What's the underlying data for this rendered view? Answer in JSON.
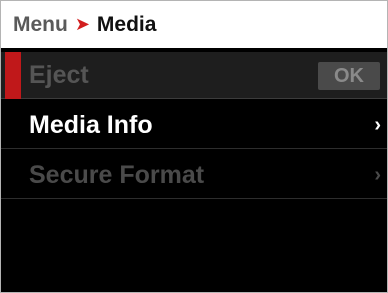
{
  "breadcrumb": {
    "root": "Menu",
    "separator": "➤",
    "current": "Media"
  },
  "menu": {
    "items": [
      {
        "label": "Eject",
        "action_label": "OK",
        "state": "selected-disabled"
      },
      {
        "label": "Media Info",
        "chevron": "›",
        "state": "enabled"
      },
      {
        "label": "Secure Format",
        "chevron": "›",
        "state": "disabled"
      }
    ]
  },
  "colors": {
    "accent": "#c0181a",
    "background": "#000000",
    "title_bar": "#ffffff",
    "disabled_text": "#555555",
    "enabled_text": "#ffffff"
  },
  "icons": {
    "breadcrumb_separator": "chevron-right-icon",
    "submenu_indicator": "chevron-right-icon"
  }
}
